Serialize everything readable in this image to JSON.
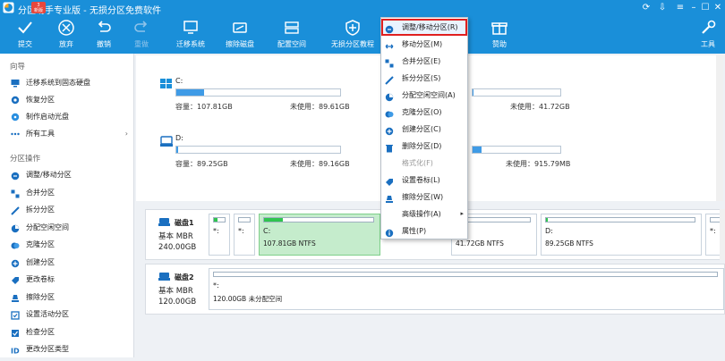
{
  "window": {
    "title": "分区助手专业版 - 无损分区免费软件",
    "badge": "3",
    "badge_label": "新版",
    "controls": [
      "refresh-icon",
      "download-icon",
      "menu-icon",
      "minimize-icon",
      "maximize-icon",
      "close-icon"
    ]
  },
  "toolbar": {
    "items": [
      {
        "label": "提交",
        "icon": "check-icon",
        "enabled": true
      },
      {
        "label": "放弃",
        "icon": "cancel-icon",
        "enabled": true
      },
      {
        "label": "撤销",
        "icon": "undo-icon",
        "enabled": true
      },
      {
        "label": "重做",
        "icon": "redo-icon",
        "enabled": false
      },
      {
        "label": "迁移系统",
        "icon": "migrate-icon",
        "enabled": true
      },
      {
        "label": "擦除磁盘",
        "icon": "wipe-disk-icon",
        "enabled": true
      },
      {
        "label": "配置空间",
        "icon": "allocate-icon",
        "enabled": true
      },
      {
        "label": "无损分区教程",
        "icon": "tutorial-icon",
        "enabled": true
      },
      {
        "label": "赞助",
        "icon": "donate-icon",
        "enabled": true
      },
      {
        "label": "工具",
        "icon": "tools-icon",
        "enabled": true
      }
    ]
  },
  "sidebar": {
    "wizard_title": "向导",
    "wizard_items": [
      {
        "label": "迁移系统到固态硬盘",
        "icon": "migrate-icon"
      },
      {
        "label": "恢复分区",
        "icon": "recover-icon"
      },
      {
        "label": "制作启动光盘",
        "icon": "bootdisk-icon"
      },
      {
        "label": "所有工具",
        "icon": "more-icon",
        "chevron": "›"
      }
    ],
    "ops_title": "分区操作",
    "ops_items": [
      {
        "label": "调整/移动分区",
        "icon": "resize-icon"
      },
      {
        "label": "合并分区",
        "icon": "merge-icon"
      },
      {
        "label": "拆分分区",
        "icon": "split-icon"
      },
      {
        "label": "分配空闲空间",
        "icon": "allocate-icon"
      },
      {
        "label": "克隆分区",
        "icon": "clone-icon"
      },
      {
        "label": "创建分区",
        "icon": "create-icon"
      },
      {
        "label": "更改卷标",
        "icon": "label-icon"
      },
      {
        "label": "擦除分区",
        "icon": "wipe-icon"
      },
      {
        "label": "设置活动分区",
        "icon": "active-icon"
      },
      {
        "label": "检查分区",
        "icon": "check-icon"
      },
      {
        "label": "更改分区类型",
        "icon": "id-icon"
      }
    ]
  },
  "volumes": [
    {
      "name": "C:",
      "capacity": "容量：107.81GB",
      "free": "未使用：89.61GB",
      "used_fraction": 0.17,
      "icon": "windows-drive-icon"
    },
    {
      "name": "D:",
      "capacity": "容量：89.25GB",
      "free": "未使用：89.16GB",
      "used_fraction": 0.01,
      "icon": "drive-icon"
    },
    {
      "name": "",
      "capacity": "",
      "free": "未使用：41.72GB",
      "used_fraction": 0.01,
      "icon": ""
    },
    {
      "name": "",
      "capacity": "",
      "free": "未使用：915.79MB",
      "used_fraction": 0.1,
      "icon": ""
    }
  ],
  "disks": [
    {
      "name": "磁盘1",
      "type": "基本 MBR",
      "size": "240.00GB",
      "partitions": [
        {
          "name": "*:",
          "detail": "",
          "used_fraction": 0.3,
          "selected": false
        },
        {
          "name": "*:",
          "detail": "",
          "used_fraction": 0,
          "selected": false
        },
        {
          "name": "C:",
          "detail": "107.81GB NTFS",
          "used_fraction": 0.17,
          "selected": true
        },
        {
          "name": "",
          "detail": "41.72GB NTFS",
          "used_fraction": 0.01,
          "selected": false
        },
        {
          "name": "D:",
          "detail": "89.25GB NTFS",
          "used_fraction": 0.01,
          "selected": false
        },
        {
          "name": "*:",
          "detail": "",
          "used_fraction": 0,
          "selected": false
        }
      ]
    },
    {
      "name": "磁盘2",
      "type": "基本 MBR",
      "size": "120.00GB",
      "partitions": [
        {
          "name": "*:",
          "detail": "120.00GB 未分配空间",
          "used_fraction": 0,
          "selected": false
        }
      ]
    }
  ],
  "context_menu": {
    "items": [
      {
        "label": "调整/移动分区(R)",
        "icon": "resize-icon",
        "highlighted": true,
        "enabled": true
      },
      {
        "label": "移动分区(M)",
        "icon": "move-icon",
        "enabled": true
      },
      {
        "label": "合并分区(E)",
        "icon": "merge-icon",
        "enabled": true
      },
      {
        "label": "拆分分区(S)",
        "icon": "split-icon",
        "enabled": true
      },
      {
        "label": "分配空闲空间(A)",
        "icon": "allocate-icon",
        "enabled": true
      },
      {
        "label": "克隆分区(O)",
        "icon": "clone-icon",
        "enabled": true
      },
      {
        "label": "创建分区(C)",
        "icon": "create-icon",
        "enabled": true
      },
      {
        "label": "删除分区(D)",
        "icon": "delete-icon",
        "enabled": true
      },
      {
        "label": "格式化(F)",
        "icon": "format-icon",
        "enabled": false
      },
      {
        "label": "设置卷标(L)",
        "icon": "label-icon",
        "enabled": true
      },
      {
        "label": "擦除分区(W)",
        "icon": "wipe-icon",
        "enabled": true
      },
      {
        "label": "高级操作(A)",
        "icon": "advanced-icon",
        "enabled": true,
        "submenu": "▸"
      },
      {
        "label": "属性(P)",
        "icon": "info-icon",
        "enabled": true
      }
    ]
  },
  "colors": {
    "accent": "#1a8fd9",
    "selected_partition": "#c5eccc",
    "used_bar": "#2fc44f",
    "volume_bar": "#3f9be6",
    "menu_highlight": "#e02020"
  }
}
